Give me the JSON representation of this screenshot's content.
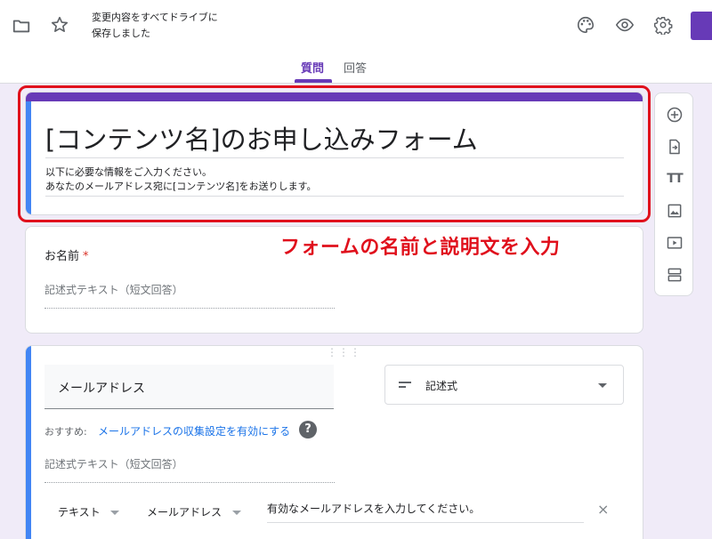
{
  "header": {
    "save_status_line1": "変更内容をすべてドライブに",
    "save_status_line2": "保存しました",
    "tabs": [
      {
        "label": "質問",
        "active": true
      },
      {
        "label": "回答",
        "active": false
      }
    ],
    "icons": [
      "folder-icon",
      "star-icon",
      "palette-icon",
      "eye-icon",
      "gear-icon"
    ],
    "accent_color": "#673ab7"
  },
  "title_card": {
    "title": "[コンテンツ名]のお申し込みフォーム",
    "description_line1": "以下に必要な情報をご入力ください。",
    "description_line2": "あなたのメールアドレス宛に[コンテンツ名]をお送りします。"
  },
  "annotation": {
    "text": "フォームの名前と説明文を入力",
    "color": "#e0101c"
  },
  "questions": [
    {
      "title": "お名前",
      "required_mark": "*",
      "answer_placeholder": "記述式テキスト（短文回答）"
    },
    {
      "title": "メールアドレス",
      "type_label": "記述式",
      "suggestion_prefix": "おすすめ:",
      "suggestion_link": "メールアドレスの収集設定を有効にする",
      "help_glyph": "?",
      "answer_placeholder": "記述式テキスト（短文回答）",
      "validation": {
        "kind": "テキスト",
        "rule": "メールアドレス",
        "error_message": "有効なメールアドレスを入力してください。",
        "close_glyph": "×"
      }
    }
  ],
  "toolbar": {
    "items": [
      "add-question-icon",
      "import-questions-icon",
      "add-title-icon",
      "add-image-icon",
      "add-video-icon",
      "add-section-icon"
    ],
    "title_glyph": "TT"
  }
}
